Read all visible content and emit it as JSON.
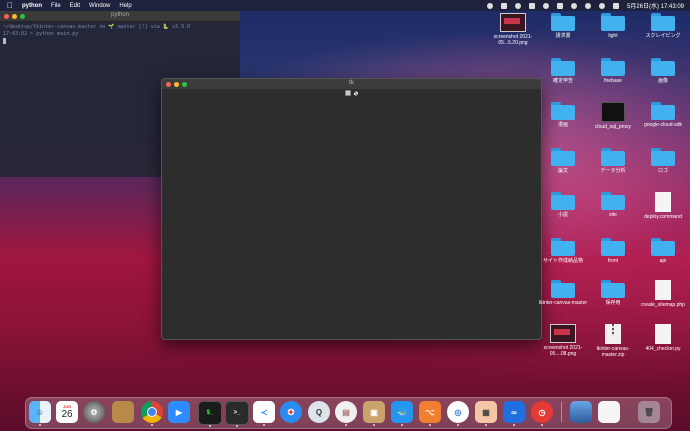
{
  "menubar": {
    "app_name": "python",
    "items": [
      "File",
      "Edit",
      "Window",
      "Help"
    ],
    "clock": "5月26日(水) 17:43:09"
  },
  "terminal": {
    "title": "python",
    "line1": "~/desktop/tkinter-canvas-master on 🌱 master [!] via 🐍 v3.9.0",
    "line2": "17:43:02 > python main.py"
  },
  "tk_window": {
    "title": "tk"
  },
  "desktop_icons": [
    {
      "label": "screenshot 2021-05...5.20.png",
      "kind": "thumb"
    },
    {
      "label": "請求書",
      "kind": "folder"
    },
    {
      "label": "light",
      "kind": "folder"
    },
    {
      "label": "スクレイピング",
      "kind": "folder"
    },
    {
      "label": "確定申告",
      "kind": "folder"
    },
    {
      "label": "firebase",
      "kind": "folder"
    },
    {
      "label": "画像",
      "kind": "folder"
    },
    {
      "label": "cloud_sql_proxy",
      "kind": "exec"
    },
    {
      "label": "google-cloud-sdk",
      "kind": "folder"
    },
    {
      "label": "漫画",
      "kind": "folder"
    },
    {
      "label": "論文",
      "kind": "folder"
    },
    {
      "label": "データ分析",
      "kind": "folder"
    },
    {
      "label": "ロゴ",
      "kind": "folder"
    },
    {
      "label": "小説",
      "kind": "folder"
    },
    {
      "label": "site",
      "kind": "folder"
    },
    {
      "label": "deploy.command",
      "kind": "doc"
    },
    {
      "label": "サイト作成納品物",
      "kind": "folder"
    },
    {
      "label": "front",
      "kind": "folder"
    },
    {
      "label": "api",
      "kind": "folder"
    },
    {
      "label": "tkinter-canvas-master",
      "kind": "folder"
    },
    {
      "label": "保存用",
      "kind": "folder"
    },
    {
      "label": "create_sitemap.php",
      "kind": "doc"
    },
    {
      "label": "screenshot 2021-05....08.png",
      "kind": "thumb"
    },
    {
      "label": "tkinter-canvas-master.zip",
      "kind": "zip"
    },
    {
      "label": "404_checker.py",
      "kind": "doc"
    }
  ],
  "dock": {
    "calendar_month": "JUN",
    "calendar_day": "26",
    "apps": [
      "finder-icon",
      "calendar-icon",
      "system-preferences-icon",
      "app-icon",
      "chrome-icon",
      "zoom-icon",
      "terminal-icon",
      "terminal-icon",
      "vscode-icon",
      "safari-icon",
      "quicktime-icon",
      "sequel-icon",
      "archive-icon",
      "docker-icon",
      "sourcetree-icon",
      "app-icon",
      "preview-icon",
      "infinity-icon",
      "clock-icon",
      "photos-icon",
      "document-icon",
      "trash-icon"
    ]
  }
}
